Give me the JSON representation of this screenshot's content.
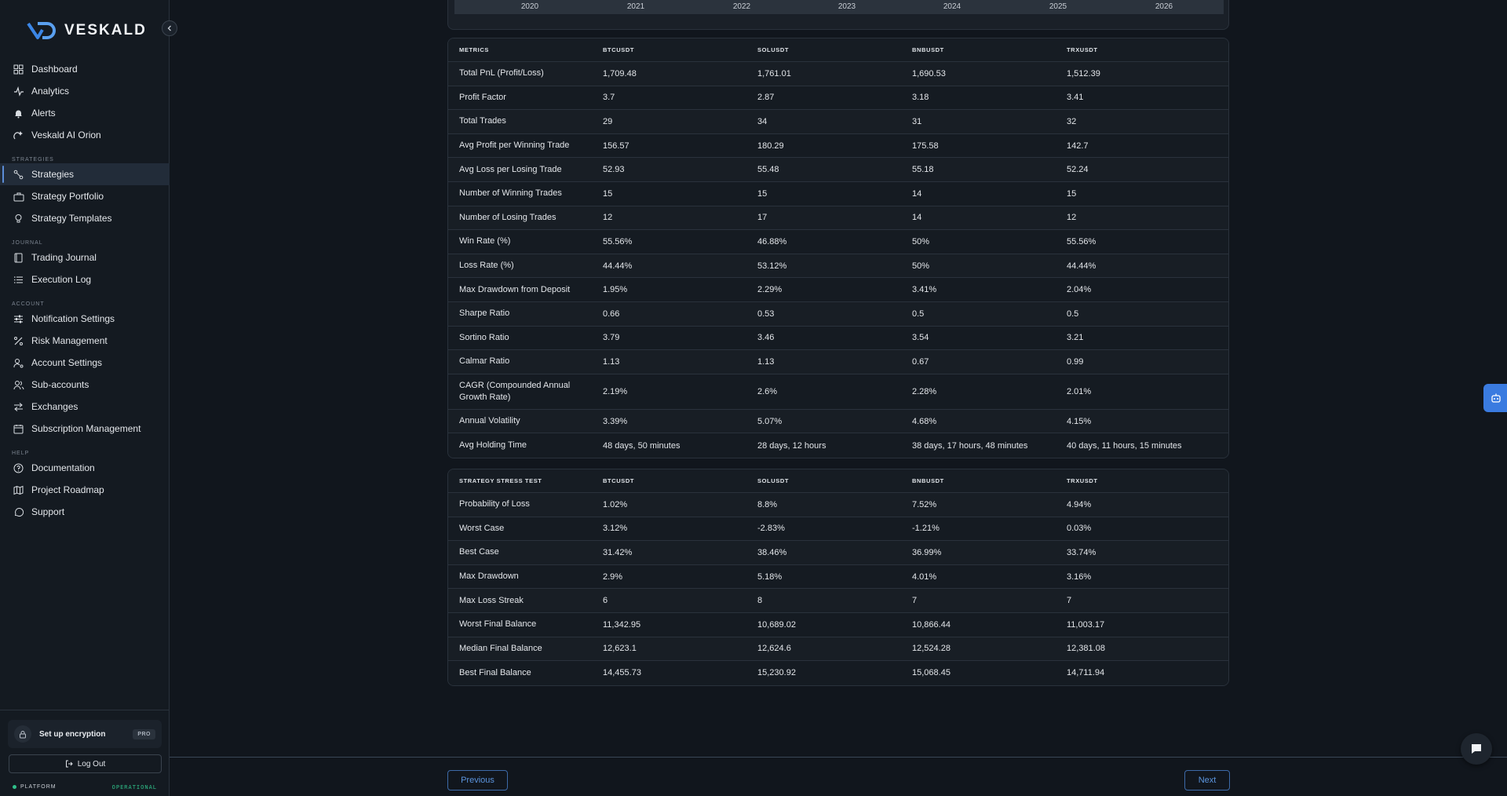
{
  "brand": {
    "name": "VESKALD"
  },
  "sidebar": {
    "items_top": [
      {
        "label": "Dashboard",
        "icon": "grid-icon"
      },
      {
        "label": "Analytics",
        "icon": "activity-icon"
      },
      {
        "label": "Alerts",
        "icon": "bell-icon"
      },
      {
        "label": "Veskald AI Orion",
        "icon": "ai-icon"
      }
    ],
    "sections": [
      {
        "title": "STRATEGIES",
        "items": [
          {
            "label": "Strategies",
            "icon": "route-icon",
            "active": true
          },
          {
            "label": "Strategy Portfolio",
            "icon": "briefcase-icon"
          },
          {
            "label": "Strategy Templates",
            "icon": "lightbulb-icon"
          }
        ]
      },
      {
        "title": "JOURNAL",
        "items": [
          {
            "label": "Trading Journal",
            "icon": "book-icon"
          },
          {
            "label": "Execution Log",
            "icon": "list-icon"
          }
        ]
      },
      {
        "title": "ACCOUNT",
        "items": [
          {
            "label": "Notification Settings",
            "icon": "sliders-icon"
          },
          {
            "label": "Risk Management",
            "icon": "percent-icon"
          },
          {
            "label": "Account Settings",
            "icon": "user-gear-icon"
          },
          {
            "label": "Sub-accounts",
            "icon": "users-icon"
          },
          {
            "label": "Exchanges",
            "icon": "swap-icon"
          },
          {
            "label": "Subscription Management",
            "icon": "calendar-icon"
          }
        ]
      },
      {
        "title": "HELP",
        "items": [
          {
            "label": "Documentation",
            "icon": "help-circle-icon"
          },
          {
            "label": "Project Roadmap",
            "icon": "map-icon"
          },
          {
            "label": "Support",
            "icon": "message-circle-icon"
          }
        ]
      }
    ],
    "encryption": {
      "label": "Set up encryption",
      "badge": "PRO"
    },
    "logout": "Log Out",
    "platform": {
      "label": "PLATFORM",
      "status": "OPERATIONAL"
    }
  },
  "chart": {
    "years": [
      "2020",
      "2021",
      "2022",
      "2023",
      "2024",
      "2025",
      "2026"
    ]
  },
  "metrics_table": {
    "headers": [
      "METRICS",
      "BTCUSDT",
      "SOLUSDT",
      "BNBUSDT",
      "TRXUSDT"
    ],
    "rows": [
      [
        "Total PnL (Profit/Loss)",
        "1,709.48",
        "1,761.01",
        "1,690.53",
        "1,512.39"
      ],
      [
        "Profit Factor",
        "3.7",
        "2.87",
        "3.18",
        "3.41"
      ],
      [
        "Total Trades",
        "29",
        "34",
        "31",
        "32"
      ],
      [
        "Avg Profit per Winning Trade",
        "156.57",
        "180.29",
        "175.58",
        "142.7"
      ],
      [
        "Avg Loss per Losing Trade",
        "52.93",
        "55.48",
        "55.18",
        "52.24"
      ],
      [
        "Number of Winning Trades",
        "15",
        "15",
        "14",
        "15"
      ],
      [
        "Number of Losing Trades",
        "12",
        "17",
        "14",
        "12"
      ],
      [
        "Win Rate (%)",
        "55.56%",
        "46.88%",
        "50%",
        "55.56%"
      ],
      [
        "Loss Rate (%)",
        "44.44%",
        "53.12%",
        "50%",
        "44.44%"
      ],
      [
        "Max Drawdown from Deposit",
        "1.95%",
        "2.29%",
        "3.41%",
        "2.04%"
      ],
      [
        "Sharpe Ratio",
        "0.66",
        "0.53",
        "0.5",
        "0.5"
      ],
      [
        "Sortino Ratio",
        "3.79",
        "3.46",
        "3.54",
        "3.21"
      ],
      [
        "Calmar Ratio",
        "1.13",
        "1.13",
        "0.67",
        "0.99"
      ],
      [
        "CAGR (Compounded Annual Growth Rate)",
        "2.19%",
        "2.6%",
        "2.28%",
        "2.01%"
      ],
      [
        "Annual Volatility",
        "3.39%",
        "5.07%",
        "4.68%",
        "4.15%"
      ],
      [
        "Avg Holding Time",
        "48 days, 50 minutes",
        "28 days, 12 hours",
        "38 days, 17 hours, 48 minutes",
        "40 days, 11 hours, 15 minutes"
      ]
    ]
  },
  "stress_table": {
    "headers": [
      "STRATEGY STRESS TEST",
      "BTCUSDT",
      "SOLUSDT",
      "BNBUSDT",
      "TRXUSDT"
    ],
    "rows": [
      [
        "Probability of Loss",
        "1.02%",
        "8.8%",
        "7.52%",
        "4.94%"
      ],
      [
        "Worst Case",
        "3.12%",
        "-2.83%",
        "-1.21%",
        "0.03%"
      ],
      [
        "Best Case",
        "31.42%",
        "38.46%",
        "36.99%",
        "33.74%"
      ],
      [
        "Max Drawdown",
        "2.9%",
        "5.18%",
        "4.01%",
        "3.16%"
      ],
      [
        "Max Loss Streak",
        "6",
        "8",
        "7",
        "7"
      ],
      [
        "Worst Final Balance",
        "11,342.95",
        "10,689.02",
        "10,866.44",
        "11,003.17"
      ],
      [
        "Median Final Balance",
        "12,623.1",
        "12,624.6",
        "12,524.28",
        "12,381.08"
      ],
      [
        "Best Final Balance",
        "14,455.73",
        "15,230.92",
        "15,068.45",
        "14,711.94"
      ]
    ]
  },
  "pager": {
    "previous": "Previous",
    "next": "Next"
  }
}
